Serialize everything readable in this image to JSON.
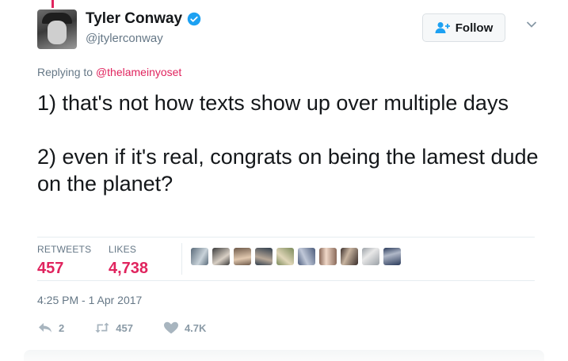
{
  "author": {
    "name": "Tyler Conway",
    "handle": "@jtylerconway",
    "verified": true
  },
  "follow_button": {
    "label": "Follow",
    "icon": "add-user-icon"
  },
  "reply": {
    "prefix": "Replying to ",
    "mention": "@thelameinyoset"
  },
  "tweet": {
    "text": "1) that's not how texts show up over multiple days\n\n2) even if it's real, congrats on being the lamest dude on the planet?"
  },
  "stats": {
    "retweets_label": "RETWEETS",
    "retweets_value": "457",
    "likes_label": "LIKES",
    "likes_value": "4,738"
  },
  "liker_avatars": [
    "avatar-1",
    "avatar-2",
    "avatar-3",
    "avatar-4",
    "avatar-5",
    "avatar-6",
    "avatar-7",
    "avatar-8",
    "avatar-9",
    "avatar-10"
  ],
  "timestamp": "4:25 PM - 1 Apr 2017",
  "actions": {
    "reply_count": "2",
    "retweet_count": "457",
    "like_count": "4.7K"
  },
  "colors": {
    "accent": "#e0245e",
    "verified": "#1da1f2",
    "muted": "#657786"
  }
}
